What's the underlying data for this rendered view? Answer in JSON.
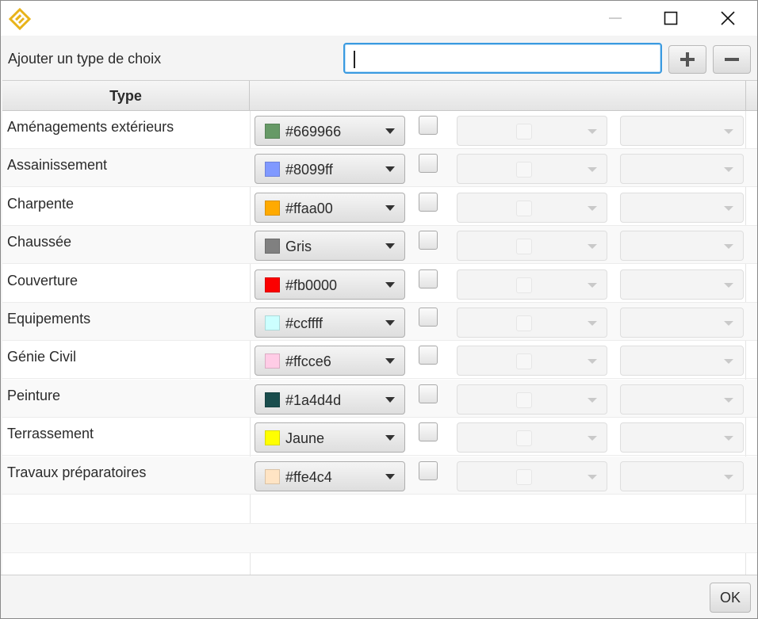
{
  "window": {
    "icons": {
      "logo": "app-logo-icon",
      "minimize": "minimize-icon",
      "maximize": "maximize-icon",
      "close": "close-icon"
    }
  },
  "toolbar": {
    "add_label": "Ajouter un type de choix",
    "input_value": "",
    "input_placeholder": "",
    "add_icon": "plus-icon",
    "remove_icon": "minus-icon"
  },
  "table": {
    "columns": [
      "Type",
      ""
    ],
    "rows": [
      {
        "label": "Aménagements extérieurs",
        "color": "#669966",
        "color_label": "#669966",
        "checked": false
      },
      {
        "label": "Assainissement",
        "color": "#8099ff",
        "color_label": "#8099ff",
        "checked": false
      },
      {
        "label": "Charpente",
        "color": "#ffaa00",
        "color_label": "#ffaa00",
        "checked": false
      },
      {
        "label": "Chaussée",
        "color": "#808080",
        "color_label": "Gris",
        "checked": false
      },
      {
        "label": "Couverture",
        "color": "#fb0000",
        "color_label": "#fb0000",
        "checked": false
      },
      {
        "label": "Equipements",
        "color": "#ccffff",
        "color_label": "#ccffff",
        "checked": false
      },
      {
        "label": "Génie Civil",
        "color": "#ffcce6",
        "color_label": "#ffcce6",
        "checked": false
      },
      {
        "label": "Peinture",
        "color": "#1a4d4d",
        "color_label": "#1a4d4d",
        "checked": false
      },
      {
        "label": "Terrassement",
        "color": "#ffff00",
        "color_label": "Jaune",
        "checked": false
      },
      {
        "label": "Travaux préparatoires",
        "color": "#ffe4c4",
        "color_label": "#ffe4c4",
        "checked": false
      }
    ]
  },
  "footer": {
    "ok_label": "OK"
  },
  "colors": {
    "accent": "#3a9ae0",
    "logo": "#e8b31a"
  }
}
